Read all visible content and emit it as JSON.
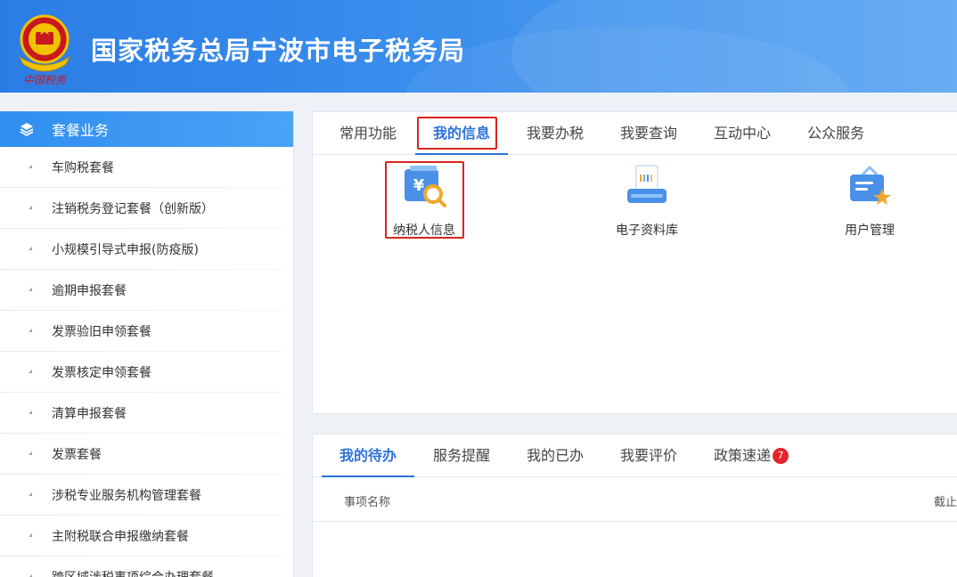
{
  "header": {
    "title": "国家税务总局宁波市电子税务局",
    "emblem_icon": "national-tax-emblem-icon",
    "emblem_caption": "中国税务"
  },
  "sidebar": {
    "heading": "套餐业务",
    "heading_icon": "layers-icon",
    "items": [
      "车购税套餐",
      "注销税务登记套餐（创新版）",
      "小规模引导式申报(防疫版)",
      "逾期申报套餐",
      "发票验旧申领套餐",
      "发票核定申领套餐",
      "清算申报套餐",
      "发票套餐",
      "涉税专业服务机构管理套餐",
      "主附税联合申报缴纳套餐",
      "跨区域涉税事项综合办理套餐"
    ]
  },
  "main_tabs": {
    "tabs": [
      "常用功能",
      "我的信息",
      "我要办税",
      "我要查询",
      "互动中心",
      "公众服务"
    ],
    "active": "我的信息"
  },
  "functions": [
    {
      "label": "纳税人信息",
      "icon": "taxpayer-info-icon"
    },
    {
      "label": "电子资料库",
      "icon": "e-document-library-icon"
    },
    {
      "label": "用户管理",
      "icon": "user-management-icon"
    }
  ],
  "todo": {
    "tabs": [
      "我的待办",
      "服务提醒",
      "我的已办",
      "我要评价",
      "政策速递"
    ],
    "active": "我的待办",
    "policy_badge": "7",
    "columns": [
      "事项名称",
      "截止"
    ]
  },
  "colors": {
    "header_blue": "#2b7de6",
    "accent": "#2b72d8",
    "highlight_red": "#d9261c",
    "badge_red": "#e5252a"
  }
}
